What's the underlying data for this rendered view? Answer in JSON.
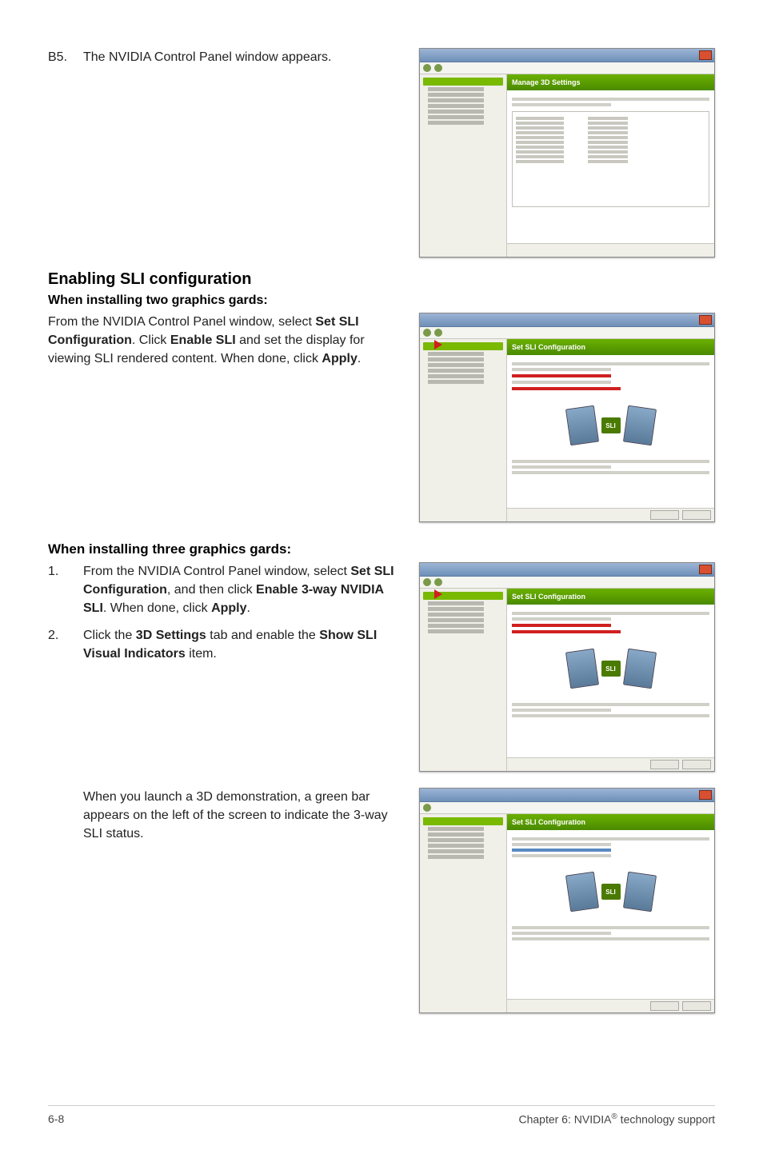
{
  "section1": {
    "num": "B5.",
    "text": "The NVIDIA Control Panel window appears.",
    "panel_title": "Manage 3D Settings"
  },
  "heading": "Enabling SLI configuration",
  "sub1": "When installing two graphics gards:",
  "para1_a": "From the NVIDIA Control Panel window, select ",
  "para1_b": "Set SLI Configuration",
  "para1_c": ". Click ",
  "para1_d": "Enable SLI",
  "para1_e": " and set the display for viewing SLI rendered content. When done, click ",
  "para1_f": "Apply",
  "para1_g": ".",
  "panel2_title": "Set SLI Configuration",
  "sub2": "When installing three graphics gards:",
  "step1_num": "1.",
  "step1_a": "From the NVIDIA Control Panel window, select ",
  "step1_b": "Set SLI Configuration",
  "step1_c": ", and then click ",
  "step1_d": "Enable 3-way NVIDIA SLI",
  "step1_e": ". When done, click ",
  "step1_f": "Apply",
  "step1_g": ".",
  "step2_num": "2.",
  "step2_a": "Click the ",
  "step2_b": "3D Settings",
  "step2_c": " tab and enable the ",
  "step2_d": "Show SLI Visual Indicators",
  "step2_e": " item.",
  "panel3_title": "Set SLI Configuration",
  "para2": "When you launch a 3D demonstration, a green bar appears on the left of the screen to indicate the 3-way SLI status.",
  "panel4_title": "Set SLI Configuration",
  "sli_badge": "SLI",
  "footer_left": "6-8",
  "footer_right_a": "Chapter 6: NVIDIA",
  "footer_right_sup": "®",
  "footer_right_b": " technology support"
}
